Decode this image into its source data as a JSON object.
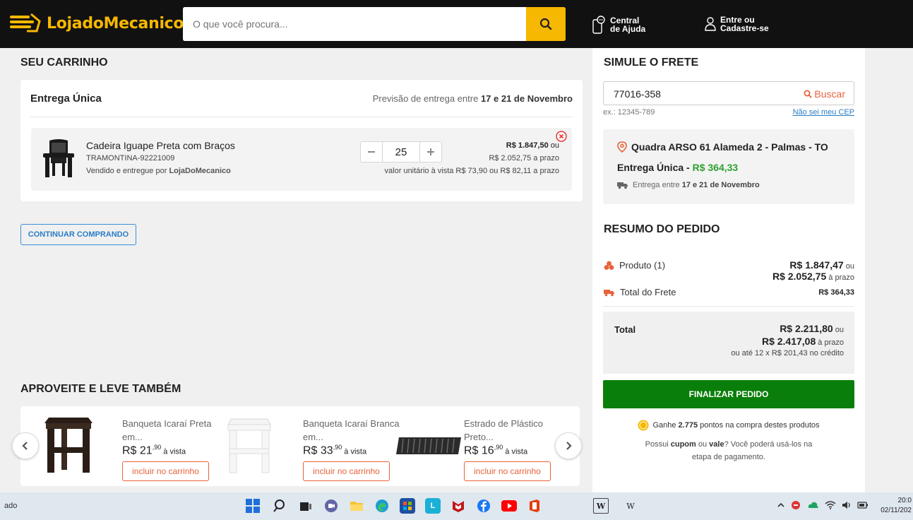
{
  "header": {
    "logo_text": "LojadoMecanico",
    "search_placeholder": "O que você procura...",
    "help_line1": "Central",
    "help_line2": "de Ajuda",
    "login_line1": "Entre ou",
    "login_line2": "Cadastre-se"
  },
  "cart": {
    "title": "SEU CARRINHO",
    "delivery_type": "Entrega Única",
    "forecast_prefix": "Previsão de entrega entre ",
    "forecast_dates": "17 e 21 de Novembro",
    "item": {
      "name": "Cadeira Iguape Preta com Braços",
      "sku": "TRAMONTINA-92221009",
      "seller_prefix": "Vendido e entregue por ",
      "seller_name": "LojaDoMecanico",
      "quantity": "25",
      "price_cash": "R$ 1.847,50",
      "price_cash_suffix": " ou",
      "price_installment": "R$ 2.052,75 a prazo",
      "unit_price": "valor unitário à vista R$ 73,90 ou R$ 82,11 a prazo"
    },
    "continue_label": "CONTINUAR COMPRANDO"
  },
  "recommendations": {
    "title": "APROVEITE E LEVE TAMBÉM",
    "items": [
      {
        "name": "Banqueta Icaraí Preta em...",
        "price_int": "R$ 21",
        "price_cents": ",90",
        "price_suffix": " à vista",
        "button": "incluir no carrinho"
      },
      {
        "name": "Banqueta Icaraí Branca em...",
        "price_int": "R$ 33",
        "price_cents": ",90",
        "price_suffix": " à vista",
        "button": "incluir no carrinho"
      },
      {
        "name": "Estrado de Plástico Preto...",
        "price_int": "R$ 16",
        "price_cents": ",90",
        "price_suffix": " à vista",
        "button": "incluir no carrinho"
      }
    ]
  },
  "shipping": {
    "title": "SIMULE O FRETE",
    "cep_value": "77016-358",
    "search_label": "Buscar",
    "example": "ex.: 12345-789",
    "unknown_cep": "Não sei meu CEP",
    "address": "Quadra ARSO 61 Alameda 2 - Palmas - TO",
    "delivery_label": "Entrega Única - ",
    "delivery_price": "R$ 364,33",
    "delivery_date_prefix": "Entrega entre ",
    "delivery_dates": "17 e 21 de Novembro"
  },
  "summary": {
    "title": "RESUMO DO PEDIDO",
    "product_label": "Produto (1)",
    "product_cash": "R$ 1.847,47",
    "product_cash_suffix": " ou",
    "product_installment": "R$ 2.052,75",
    "product_installment_suffix": " à prazo",
    "freight_label": "Total do Frete",
    "freight_value": "R$ 364,33",
    "total_label": "Total",
    "total_cash": "R$ 2.211,80",
    "total_cash_suffix": " ou",
    "total_installment": "R$ 2.417,08",
    "total_installment_suffix": " à prazo",
    "total_credit": "ou até 12 x R$ 201,43 no crédito",
    "finalize_label": "FINALIZAR PEDIDO",
    "points_prefix": "Ganhe ",
    "points_value": "2.775",
    "points_suffix": " pontos na compra destes produtos",
    "coupon_text_1": "Possui ",
    "coupon_word": "cupom",
    "coupon_text_2": " ou ",
    "voucher_word": "vale",
    "coupon_text_3": "? Você poderá usá-los na etapa de pagamento."
  },
  "taskbar": {
    "left_text": "ado",
    "time": "20:0",
    "date": "02/11/202"
  },
  "colors": {
    "brand_yellow": "#f6b800",
    "header_bg": "#111111",
    "accent_orange": "#e8623a",
    "finalize_green": "#0a7e0a",
    "link_blue": "#2a7cc7"
  }
}
